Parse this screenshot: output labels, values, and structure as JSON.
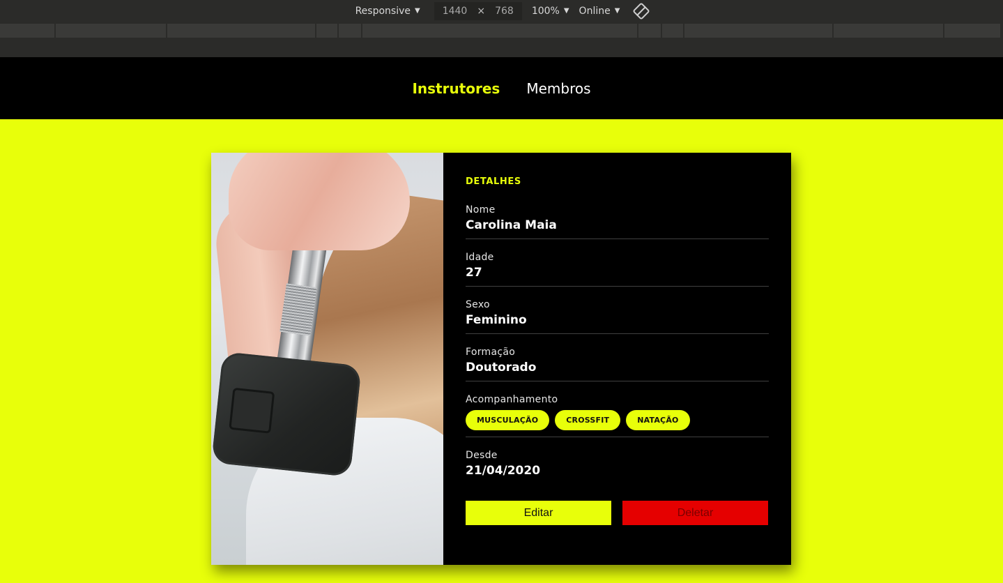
{
  "devtools": {
    "device": "Responsive",
    "width": "1440",
    "height": "768",
    "zoom": "100%",
    "network": "Online"
  },
  "nav": {
    "items": [
      {
        "label": "Instrutores",
        "active": true
      },
      {
        "label": "Membros",
        "active": false
      }
    ]
  },
  "card": {
    "section_title": "DETALHES",
    "fields": {
      "nome": {
        "label": "Nome",
        "value": "Carolina Maia"
      },
      "idade": {
        "label": "Idade",
        "value": "27"
      },
      "sexo": {
        "label": "Sexo",
        "value": "Feminino"
      },
      "formacao": {
        "label": "Formação",
        "value": "Doutorado"
      },
      "acompanhamento": {
        "label": "Acompanhamento",
        "services": [
          "MUSCULAÇÃO",
          "CROSSFIT",
          "NATAÇÃO"
        ]
      },
      "desde": {
        "label": "Desde",
        "value": "21/04/2020"
      }
    },
    "buttons": {
      "edit": "Editar",
      "delete": "Deletar"
    }
  },
  "colors": {
    "accent": "#e8ff0a",
    "danger": "#e50000",
    "header": "#000000"
  }
}
